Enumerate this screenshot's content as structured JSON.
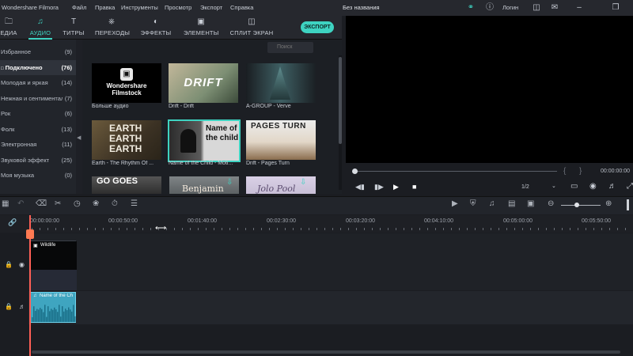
{
  "titlebar": {
    "app_name": "Wondershare Filmora",
    "menu": [
      "Файл",
      "Правка",
      "Инструменты",
      "Просмотр",
      "Экспорт",
      "Справка"
    ],
    "project_title": "Без названия",
    "login": "Логин"
  },
  "toolbar": {
    "tabs": [
      {
        "label": "ЕДИА",
        "icon": "folder-icon"
      },
      {
        "label": "АУДИО",
        "icon": "music-icon"
      },
      {
        "label": "ТИТРЫ",
        "icon": "text-icon"
      },
      {
        "label": "ПЕРЕХОДЫ",
        "icon": "transition-icon"
      },
      {
        "label": "ЭФФЕКТЫ",
        "icon": "effects-icon"
      },
      {
        "label": "ЭЛЕМЕНТЫ",
        "icon": "elements-icon"
      },
      {
        "label": "СПЛИТ ЭКРАН",
        "icon": "split-screen-icon"
      }
    ],
    "active_tab": "АУДИО",
    "export_label": "ЭКСПОРТ",
    "accent_color": "#3ed3c1"
  },
  "sidebar": {
    "categories": [
      {
        "label": "Избранное",
        "count": "(9)"
      },
      {
        "label": "Подключено",
        "count": "(76)"
      },
      {
        "label": "Молодая и яркая",
        "count": "(14)"
      },
      {
        "label": "Нежная и сентименталь",
        "count": "(7)"
      },
      {
        "label": "Рок",
        "count": "(6)"
      },
      {
        "label": "Фолк",
        "count": "(13)"
      },
      {
        "label": "Электронная",
        "count": "(11)"
      },
      {
        "label": "Звуковой эффект",
        "count": "(25)"
      },
      {
        "label": "Моя музыка",
        "count": "(0)"
      }
    ],
    "selected": "Подключено"
  },
  "media": {
    "search_placeholder": "Поиск",
    "items": [
      {
        "title": "Больше аудио",
        "thumb_text": "Wondershare\nFilmstock"
      },
      {
        "title": "Drift - Drift",
        "thumb_text": "DRIFT"
      },
      {
        "title": "A-GROUP - Verve",
        "thumb_text": ""
      },
      {
        "title": "Earth - The Rhythm Of ...",
        "thumb_text": "EARTH EARTH EARTH"
      },
      {
        "title": "Name of the Child - Moti...",
        "thumb_text": "Name of the child"
      },
      {
        "title": "Drift - Pages Turn",
        "thumb_text": "PAGES TURN"
      },
      {
        "title": "",
        "thumb_text": "GO GOES"
      },
      {
        "title": "",
        "thumb_text": "Benjamin"
      },
      {
        "title": "",
        "thumb_text": "Jolo Pool"
      }
    ]
  },
  "player": {
    "timecode": "00:00:00:00",
    "quality": "1/2"
  },
  "timeline": {
    "ruler": [
      "00:00:00:00",
      "00:00:50:00",
      "00:01:40:00",
      "00:02:30:00",
      "00:03:20:00",
      "00:04:10:00",
      "00:05:00:00",
      "00:05:50:00"
    ],
    "video_clip": "Wildlife",
    "audio_clip": "Name of the Ch"
  }
}
